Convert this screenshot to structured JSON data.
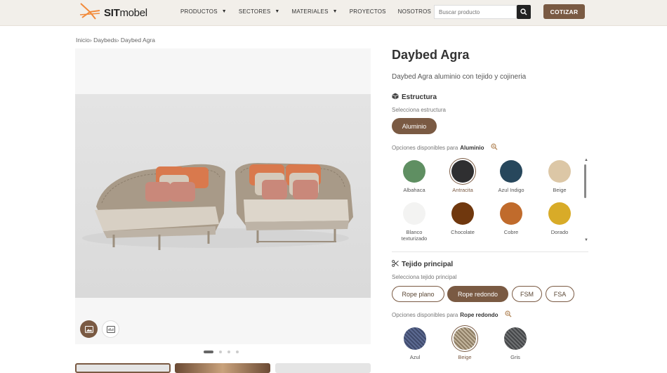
{
  "brand": {
    "bold": "SIT",
    "light": "mobel",
    "accent": "#f28a3a"
  },
  "nav": [
    {
      "label": "PRODUCTOS",
      "caret": true
    },
    {
      "label": "SECTORES",
      "caret": true
    },
    {
      "label": "MATERIALES",
      "caret": true
    },
    {
      "label": "PROYECTOS",
      "caret": false
    },
    {
      "label": "NOSOTROS",
      "caret": false
    }
  ],
  "search": {
    "placeholder": "Buscar producto"
  },
  "cta": {
    "label": "COTIZAR"
  },
  "breadcrumb": [
    "Inicio",
    "Daybeds",
    "Daybed Agra"
  ],
  "product": {
    "title": "Daybed Agra",
    "subtitle": "Daybed Agra aluminio con tejido y cojineria"
  },
  "estructura": {
    "title": "Estructura",
    "hint": "Selecciona estructura",
    "selected": "Aluminio",
    "options_prefix": "Opciones disponibles para",
    "colors": [
      {
        "name": "Albahaca",
        "hex": "#5f8f62"
      },
      {
        "name": "Antracita",
        "hex": "#2f2f31",
        "selected": true
      },
      {
        "name": "Azul Indigo",
        "hex": "#27475c"
      },
      {
        "name": "Beige",
        "hex": "#dcc7a6"
      },
      {
        "name": "Blanco texturizado",
        "hex": "#f3f3f2"
      },
      {
        "name": "Chocolate",
        "hex": "#70380e"
      },
      {
        "name": "Cobre",
        "hex": "#c06b2c"
      },
      {
        "name": "Dorado",
        "hex": "#d8ab28"
      }
    ]
  },
  "tejido": {
    "title": "Tejido principal",
    "hint": "Selecciona tejido principal",
    "options": [
      "Rope plano",
      "Rope redondo",
      "FSM",
      "FSA"
    ],
    "selected": "Rope redondo",
    "options_prefix": "Opciones disponibles para",
    "fabrics": [
      {
        "name": "Azul",
        "hex": "#3f4a6b"
      },
      {
        "name": "Beige",
        "hex": "#a8987f",
        "selected": true
      },
      {
        "name": "Gris",
        "hex": "#555759"
      }
    ]
  },
  "accent": "#7a5a43"
}
